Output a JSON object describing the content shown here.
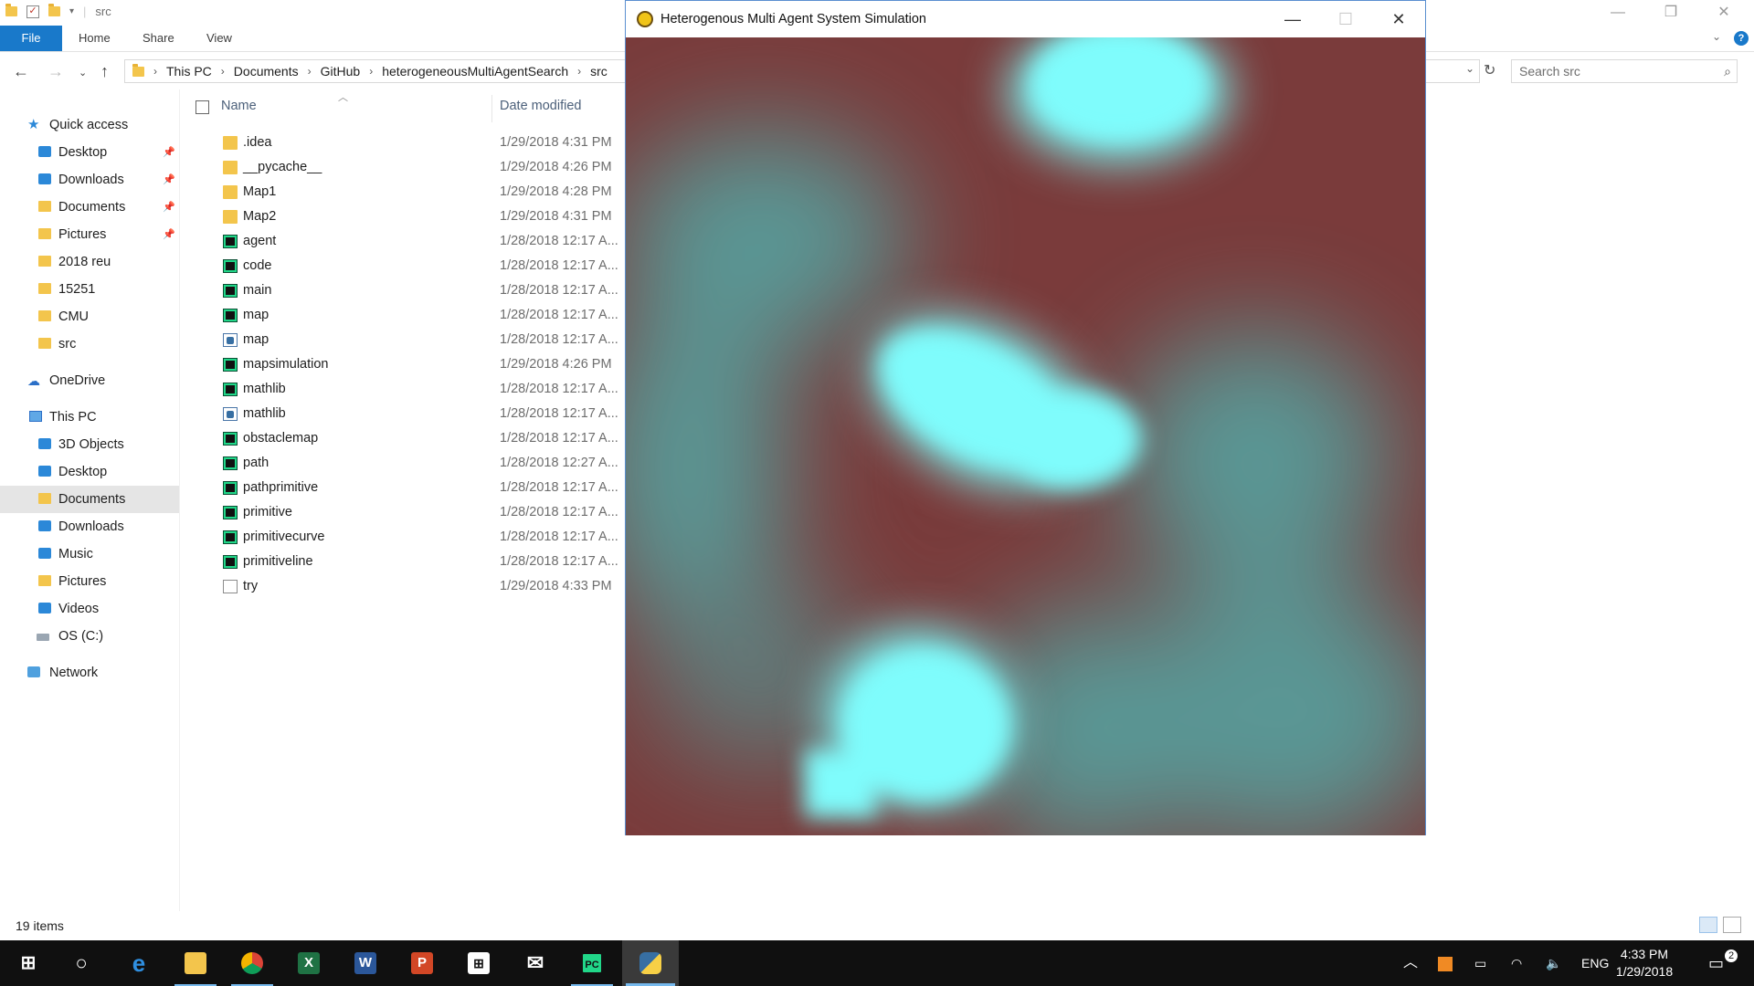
{
  "explorer": {
    "title": "src",
    "ribbon_tabs": [
      "File",
      "Home",
      "Share",
      "View"
    ],
    "breadcrumb": [
      "This PC",
      "Documents",
      "GitHub",
      "heterogeneousMultiAgentSearch",
      "src"
    ],
    "search_placeholder": "Search src",
    "nav": {
      "quick_access": "Quick access",
      "quick_items": [
        "Desktop",
        "Downloads",
        "Documents",
        "Pictures",
        "2018 reu",
        "15251",
        "CMU",
        "src"
      ],
      "onedrive": "OneDrive",
      "this_pc": "This PC",
      "pc_items": [
        "3D Objects",
        "Desktop",
        "Documents",
        "Downloads",
        "Music",
        "Pictures",
        "Videos",
        "OS (C:)"
      ],
      "network": "Network"
    },
    "columns": {
      "name": "Name",
      "date": "Date modified"
    },
    "files": [
      {
        "name": ".idea",
        "date": "1/29/2018 4:31 PM",
        "icon": "folder"
      },
      {
        "name": "__pycache__",
        "date": "1/29/2018 4:26 PM",
        "icon": "folder"
      },
      {
        "name": "Map1",
        "date": "1/29/2018 4:28 PM",
        "icon": "folder"
      },
      {
        "name": "Map2",
        "date": "1/29/2018 4:31 PM",
        "icon": "folder"
      },
      {
        "name": "agent",
        "date": "1/28/2018 12:17 A...",
        "icon": "pycharm"
      },
      {
        "name": "code",
        "date": "1/28/2018 12:17 A...",
        "icon": "pycharm"
      },
      {
        "name": "main",
        "date": "1/28/2018 12:17 A...",
        "icon": "pycharm"
      },
      {
        "name": "map",
        "date": "1/28/2018 12:17 A...",
        "icon": "pycharm"
      },
      {
        "name": "map",
        "date": "1/28/2018 12:17 A...",
        "icon": "python"
      },
      {
        "name": "mapsimulation",
        "date": "1/29/2018 4:26 PM",
        "icon": "pycharm"
      },
      {
        "name": "mathlib",
        "date": "1/28/2018 12:17 A...",
        "icon": "pycharm"
      },
      {
        "name": "mathlib",
        "date": "1/28/2018 12:17 A...",
        "icon": "python"
      },
      {
        "name": "obstaclemap",
        "date": "1/28/2018 12:17 A...",
        "icon": "pycharm"
      },
      {
        "name": "path",
        "date": "1/28/2018 12:27 A...",
        "icon": "pycharm"
      },
      {
        "name": "pathprimitive",
        "date": "1/28/2018 12:17 A...",
        "icon": "pycharm"
      },
      {
        "name": "primitive",
        "date": "1/28/2018 12:17 A...",
        "icon": "pycharm"
      },
      {
        "name": "primitivecurve",
        "date": "1/28/2018 12:17 A...",
        "icon": "pycharm"
      },
      {
        "name": "primitiveline",
        "date": "1/28/2018 12:17 A...",
        "icon": "pycharm"
      },
      {
        "name": "try",
        "date": "1/29/2018 4:33 PM",
        "icon": "text"
      }
    ],
    "status": "19 items"
  },
  "sim_window": {
    "title": "Heterogenous Multi Agent System Simulation",
    "colors": {
      "background": "#7a3b3b",
      "blob": "#7ffcfc"
    }
  },
  "taskbar": {
    "apps": [
      "start",
      "cortana",
      "edge",
      "file-explorer",
      "chrome",
      "excel",
      "word",
      "powerpoint",
      "store",
      "mail",
      "pycharm",
      "python"
    ],
    "language": "ENG",
    "time": "4:33 PM",
    "date": "1/29/2018",
    "notification_count": "2"
  }
}
